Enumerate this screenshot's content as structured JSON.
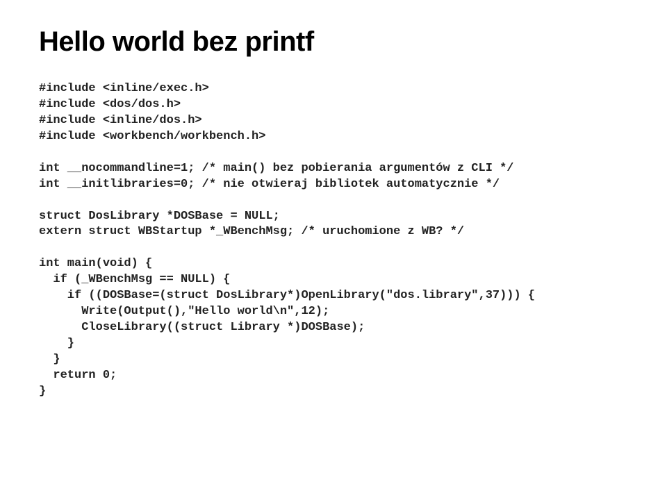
{
  "title": "Hello world bez printf",
  "code": {
    "l01": "#include <inline/exec.h>",
    "l02": "#include <dos/dos.h>",
    "l03": "#include <inline/dos.h>",
    "l04": "#include <workbench/workbench.h>",
    "l05": "int __nocommandline=1; /* main() bez pobierania argumentów z CLI */",
    "l06": "int __initlibraries=0; /* nie otwieraj bibliotek automatycznie */",
    "l07": "struct DosLibrary *DOSBase = NULL;",
    "l08": "extern struct WBStartup *_WBenchMsg; /* uruchomione z WB? */",
    "l09": "int main(void) {",
    "l10": "  if (_WBenchMsg == NULL) {",
    "l11": "    if ((DOSBase=(struct DosLibrary*)OpenLibrary(\"dos.library\",37))) {",
    "l12": "      Write(Output(),\"Hello world\\n\",12);",
    "l13": "      CloseLibrary((struct Library *)DOSBase);",
    "l14": "    }",
    "l15": "  }",
    "l16": "  return 0;",
    "l17": "}"
  }
}
